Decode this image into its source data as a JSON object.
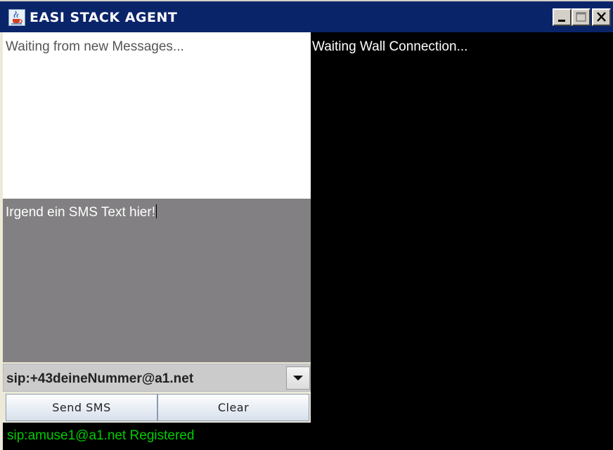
{
  "window": {
    "title": "EASI STACK AGENT",
    "app_icon": "java-cup-icon",
    "controls": [
      "minimize-icon",
      "maximize-icon",
      "close-icon"
    ]
  },
  "messages": {
    "text": "Waiting from new Messages..."
  },
  "wall": {
    "text": "Waiting Wall Connection..."
  },
  "sms": {
    "text": "Irgend ein SMS Text hier!"
  },
  "recipient": {
    "selected": "sip:+43deineNummer@a1.net"
  },
  "buttons": {
    "send_label": "Send SMS",
    "clear_label": "Clear"
  },
  "status": {
    "text": "sip:amuse1@a1.net Registered",
    "color": "#00cc00"
  },
  "colors": {
    "titlebar": "#0a246a",
    "wall_bg": "#000000",
    "sms_bg": "#828082"
  }
}
